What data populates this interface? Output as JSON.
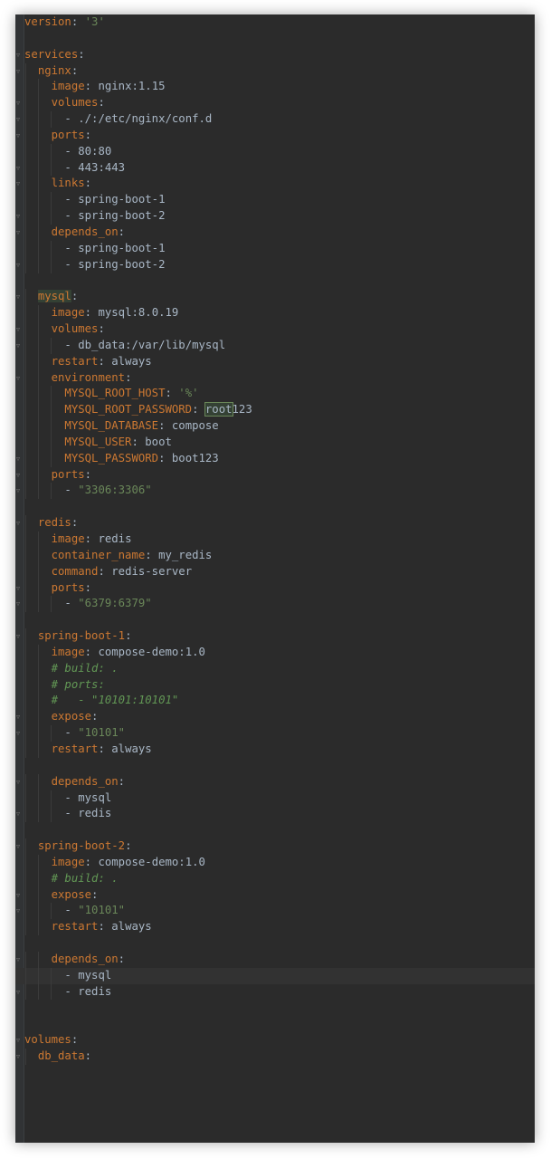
{
  "file": {
    "lines": [
      {
        "indent": 0,
        "key": "version",
        "value": "'3'",
        "vtype": "s",
        "fold": false
      },
      {
        "blank": true
      },
      {
        "indent": 0,
        "key": "services",
        "value": "",
        "fold": true
      },
      {
        "indent": 1,
        "key": "nginx",
        "value": "",
        "fold": true
      },
      {
        "indent": 2,
        "key": "image",
        "value": "nginx:1.15",
        "fold": false
      },
      {
        "indent": 2,
        "key": "volumes",
        "value": "",
        "fold": true
      },
      {
        "indent": 3,
        "item": "./:/etc/nginx/conf.d",
        "fold": true
      },
      {
        "indent": 2,
        "key": "ports",
        "value": "",
        "fold": true
      },
      {
        "indent": 3,
        "item": "80:80",
        "fold": false
      },
      {
        "indent": 3,
        "item": "443:443",
        "fold": true
      },
      {
        "indent": 2,
        "key": "links",
        "value": "",
        "fold": true
      },
      {
        "indent": 3,
        "item": "spring-boot-1",
        "fold": false
      },
      {
        "indent": 3,
        "item": "spring-boot-2",
        "fold": true
      },
      {
        "indent": 2,
        "key": "depends_on",
        "value": "",
        "fold": true
      },
      {
        "indent": 3,
        "item": "spring-boot-1",
        "fold": false
      },
      {
        "indent": 3,
        "item": "spring-boot-2",
        "fold": true
      },
      {
        "blank": true
      },
      {
        "indent": 1,
        "key": "mysql",
        "value": "",
        "fold": true,
        "hlkey": true
      },
      {
        "indent": 2,
        "key": "image",
        "value": "mysql:8.0.19",
        "fold": false
      },
      {
        "indent": 2,
        "key": "volumes",
        "value": "",
        "fold": true
      },
      {
        "indent": 3,
        "item": "db_data:/var/lib/mysql",
        "fold": true
      },
      {
        "indent": 2,
        "key": "restart",
        "value": "always",
        "fold": false
      },
      {
        "indent": 2,
        "key": "environment",
        "value": "",
        "fold": true
      },
      {
        "indent": 3,
        "key": "MYSQL_ROOT_HOST",
        "value": "'%'",
        "vtype": "s",
        "fold": false
      },
      {
        "indent": 3,
        "key": "MYSQL_ROOT_PASSWORD",
        "value": "root123",
        "sel": "root",
        "fold": false
      },
      {
        "indent": 3,
        "key": "MYSQL_DATABASE",
        "value": "compose",
        "fold": false
      },
      {
        "indent": 3,
        "key": "MYSQL_USER",
        "value": "boot",
        "fold": false
      },
      {
        "indent": 3,
        "key": "MYSQL_PASSWORD",
        "value": "boot123",
        "fold": true
      },
      {
        "indent": 2,
        "key": "ports",
        "value": "",
        "fold": true
      },
      {
        "indent": 3,
        "item": "\"3306:3306\"",
        "vtype": "s",
        "fold": true
      },
      {
        "blank": true
      },
      {
        "indent": 1,
        "key": "redis",
        "value": "",
        "fold": true
      },
      {
        "indent": 2,
        "key": "image",
        "value": "redis",
        "fold": false
      },
      {
        "indent": 2,
        "key": "container_name",
        "value": "my_redis",
        "fold": false
      },
      {
        "indent": 2,
        "key": "command",
        "value": "redis-server",
        "fold": false
      },
      {
        "indent": 2,
        "key": "ports",
        "value": "",
        "fold": true
      },
      {
        "indent": 3,
        "item": "\"6379:6379\"",
        "vtype": "s",
        "fold": true
      },
      {
        "blank": true
      },
      {
        "indent": 1,
        "key": "spring-boot-1",
        "value": "",
        "fold": true
      },
      {
        "indent": 2,
        "key": "image",
        "value": "compose-demo:1.0",
        "fold": false
      },
      {
        "indent": 2,
        "comment": "# build: .",
        "fold": false
      },
      {
        "indent": 2,
        "comment": "# ports:",
        "fold": false
      },
      {
        "indent": 2,
        "comment": "#   - \"10101:10101\"",
        "fold": false
      },
      {
        "indent": 2,
        "key": "expose",
        "value": "",
        "fold": true
      },
      {
        "indent": 3,
        "item": "\"10101\"",
        "vtype": "s",
        "fold": true
      },
      {
        "indent": 2,
        "key": "restart",
        "value": "always",
        "fold": false
      },
      {
        "blank": true
      },
      {
        "indent": 2,
        "key": "depends_on",
        "value": "",
        "fold": true
      },
      {
        "indent": 3,
        "item": "mysql",
        "fold": false
      },
      {
        "indent": 3,
        "item": "redis",
        "fold": true
      },
      {
        "blank": true
      },
      {
        "indent": 1,
        "key": "spring-boot-2",
        "value": "",
        "fold": true
      },
      {
        "indent": 2,
        "key": "image",
        "value": "compose-demo:1.0",
        "fold": false
      },
      {
        "indent": 2,
        "comment": "# build: .",
        "fold": false
      },
      {
        "indent": 2,
        "key": "expose",
        "value": "",
        "fold": true
      },
      {
        "indent": 3,
        "item": "\"10101\"",
        "vtype": "s",
        "fold": true
      },
      {
        "indent": 2,
        "key": "restart",
        "value": "always",
        "fold": false
      },
      {
        "blank": true
      },
      {
        "indent": 2,
        "key": "depends_on",
        "value": "",
        "fold": true
      },
      {
        "indent": 3,
        "item": "mysql",
        "fold": false,
        "current": true
      },
      {
        "indent": 3,
        "item": "redis",
        "fold": true
      },
      {
        "blank": true
      },
      {
        "blank": true
      },
      {
        "indent": 0,
        "key": "volumes",
        "value": "",
        "fold": true
      },
      {
        "indent": 1,
        "key": "db_data",
        "value": "",
        "fold": true
      }
    ]
  },
  "colors": {
    "background": "#2b2b2b",
    "key": "#cc7832",
    "string": "#6a8759",
    "comment": "#629755",
    "text": "#a9b7c6"
  }
}
